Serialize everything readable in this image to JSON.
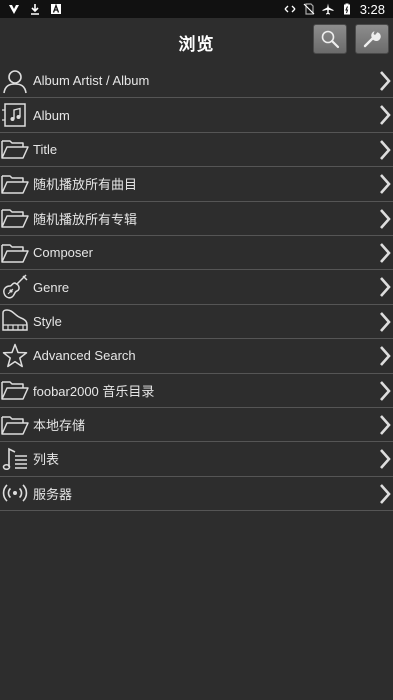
{
  "status": {
    "time": "3:28"
  },
  "header": {
    "title": "浏览"
  },
  "rows": [
    {
      "label": "Album Artist / Album",
      "icon": "person-icon"
    },
    {
      "label": "Album",
      "icon": "album-icon"
    },
    {
      "label": "Title",
      "icon": "folder-icon"
    },
    {
      "label": "随机播放所有曲目",
      "icon": "folder-icon"
    },
    {
      "label": "随机播放所有专辑",
      "icon": "folder-icon"
    },
    {
      "label": "Composer",
      "icon": "folder-icon"
    },
    {
      "label": "Genre",
      "icon": "guitar-icon"
    },
    {
      "label": "Style",
      "icon": "piano-icon"
    },
    {
      "label": "Advanced Search",
      "icon": "star-icon"
    },
    {
      "label": "foobar2000 音乐目录",
      "icon": "folder-icon"
    },
    {
      "label": "本地存储",
      "icon": "folder-icon"
    },
    {
      "label": "列表",
      "icon": "playlist-icon"
    },
    {
      "label": "服务器",
      "icon": "broadcast-icon"
    }
  ]
}
